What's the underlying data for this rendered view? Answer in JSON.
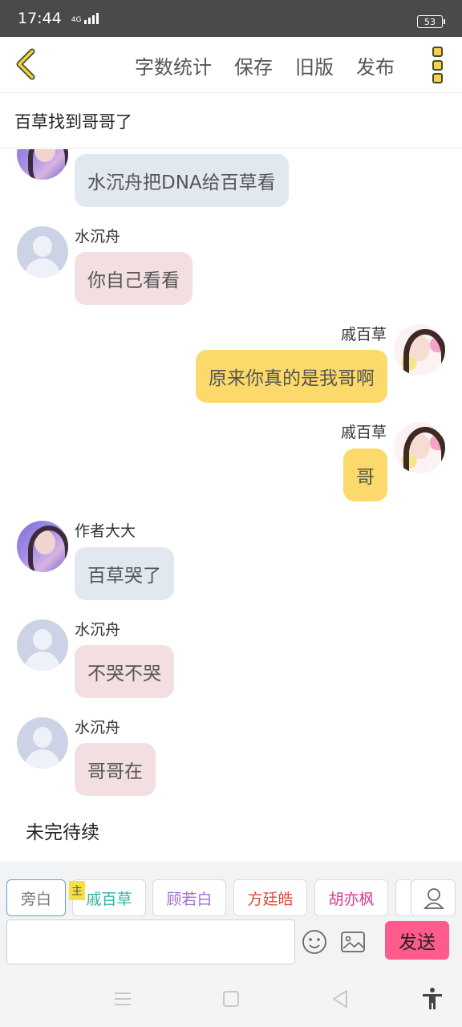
{
  "status_bar": {
    "time": "17:44",
    "network": "4G",
    "battery": "53"
  },
  "toolbar": {
    "word_count": "字数统计",
    "save": "保存",
    "old_version": "旧版",
    "publish": "发布"
  },
  "story_title": "百草找到哥哥了",
  "messages": [
    {
      "name": "",
      "text": "水沉舟把DNA给百草看"
    },
    {
      "name": "水沉舟",
      "text": "你自己看看"
    },
    {
      "name": "戚百草",
      "text": "原来你真的是我哥啊"
    },
    {
      "name": "戚百草",
      "text": "哥"
    },
    {
      "name": "作者大大",
      "text": "百草哭了"
    },
    {
      "name": "水沉舟",
      "text": "不哭不哭"
    },
    {
      "name": "水沉舟",
      "text": "哥哥在"
    }
  ],
  "narration": "未完待续",
  "roles": [
    {
      "label": "旁白",
      "color": "#777777"
    },
    {
      "label": "戚百草",
      "color": "#33b3a6"
    },
    {
      "label": "顾若白",
      "color": "#a070d0"
    },
    {
      "label": "方廷皓",
      "color": "#e0483a"
    },
    {
      "label": "胡亦枫",
      "color": "#d8388a"
    }
  ],
  "main_badge": "主",
  "input": {
    "value": "",
    "placeholder": ""
  },
  "send_label": "发送",
  "icons": {
    "back": "chevron-left-icon",
    "more": "more-vertical-icon",
    "profile": "person-icon",
    "emoji": "smiley-icon",
    "image": "image-icon",
    "nav_menu": "menu-icon",
    "nav_home": "square-icon",
    "nav_back": "triangle-back-icon",
    "accessibility": "accessibility-icon"
  },
  "colors": {
    "accent_yellow": "#fbd96a",
    "send_pink": "#ff5c8d",
    "bubble_blue": "#e2e8f0",
    "bubble_pink": "#f3dfe1"
  }
}
